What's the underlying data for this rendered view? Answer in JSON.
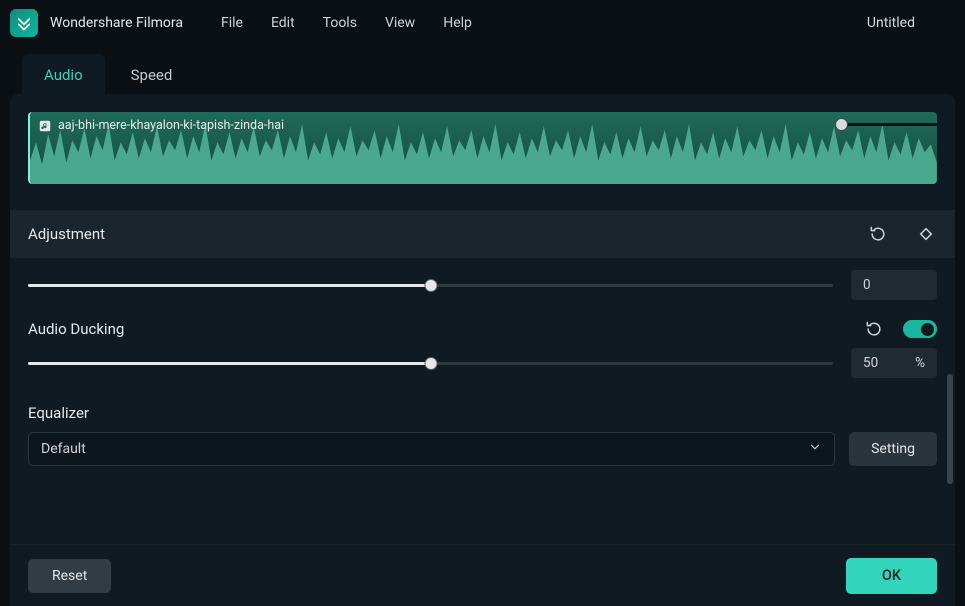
{
  "app": {
    "title": "Wondershare Filmora",
    "doc_title": "Untitled"
  },
  "menu": {
    "file": "File",
    "edit": "Edit",
    "tools": "Tools",
    "view": "View",
    "help": "Help"
  },
  "tabs": {
    "audio": "Audio",
    "speed": "Speed"
  },
  "clip": {
    "name": "aaj-bhi-mere-khayalon-ki-tapish-zinda-hai"
  },
  "adjustment": {
    "label": "Adjustment",
    "value": "0",
    "slider_pct": 50
  },
  "ducking": {
    "label": "Audio Ducking",
    "value": "50",
    "unit": "%",
    "slider_pct": 50,
    "enabled": true
  },
  "equalizer": {
    "label": "Equalizer",
    "selected": "Default",
    "setting_btn": "Setting"
  },
  "footer": {
    "reset": "Reset",
    "ok": "OK"
  }
}
